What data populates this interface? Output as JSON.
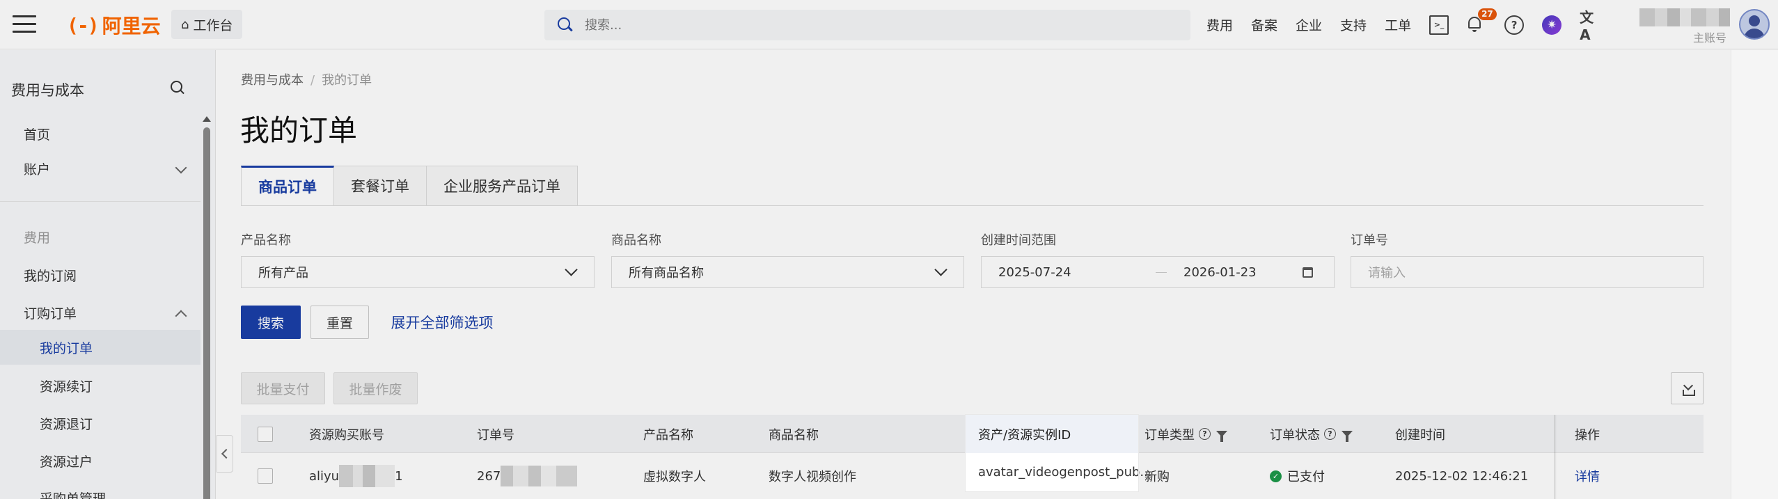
{
  "topbar": {
    "logo_mark": "(-)",
    "logo_text": "阿里云",
    "workbench_label": "工作台",
    "search_placeholder": "搜索...",
    "nav": [
      "费用",
      "备案",
      "企业",
      "支持",
      "工单"
    ],
    "notification_count": "27",
    "account_label": "主账号"
  },
  "sidebar": {
    "title": "费用与成本",
    "items": [
      {
        "label": "首页"
      },
      {
        "label": "账户"
      },
      {
        "label": "费用"
      },
      {
        "label": "我的订阅"
      },
      {
        "label": "订购订单"
      },
      {
        "label": "我的订单"
      },
      {
        "label": "资源续订"
      },
      {
        "label": "资源退订"
      },
      {
        "label": "资源过户"
      },
      {
        "label": "采购单管理"
      }
    ]
  },
  "breadcrumb": {
    "root": "费用与成本",
    "sep": "/",
    "current": "我的订单"
  },
  "page_title": "我的订单",
  "tabs": [
    {
      "label": "商品订单"
    },
    {
      "label": "套餐订单"
    },
    {
      "label": "企业服务产品订单"
    }
  ],
  "filters": {
    "product_label": "产品名称",
    "product_value": "所有产品",
    "item_label": "商品名称",
    "item_value": "所有商品名称",
    "date_label": "创建时间范围",
    "date_start": "2025-07-24",
    "date_end": "2026-01-23",
    "order_label": "订单号",
    "order_placeholder": "请输入"
  },
  "buttons": {
    "search": "搜索",
    "reset": "重置",
    "expand": "展开全部筛选项",
    "batch_pay": "批量支付",
    "batch_void": "批量作废"
  },
  "table": {
    "headers": {
      "account": "资源购买账号",
      "order_no": "订单号",
      "product": "产品名称",
      "item": "商品名称",
      "instance": "资产/资源实例ID",
      "type": "订单类型",
      "status": "订单状态",
      "created": "创建时间",
      "action": "操作"
    },
    "rows": [
      {
        "account_prefix": "aliyu",
        "account_suffix": "1",
        "order_prefix": "267",
        "product": "虚拟数字人",
        "item": "数字人视频创作",
        "instance": "avatar_videogenpost_pub...",
        "type": "新购",
        "status": "已支付",
        "created": "2025-12-02 12:46:21",
        "action": "详情"
      }
    ]
  },
  "colors": {
    "accent": "#1a3fa8",
    "brand": "#ff6a00",
    "success": "#1d9a4a",
    "badge": "#e8590c"
  }
}
